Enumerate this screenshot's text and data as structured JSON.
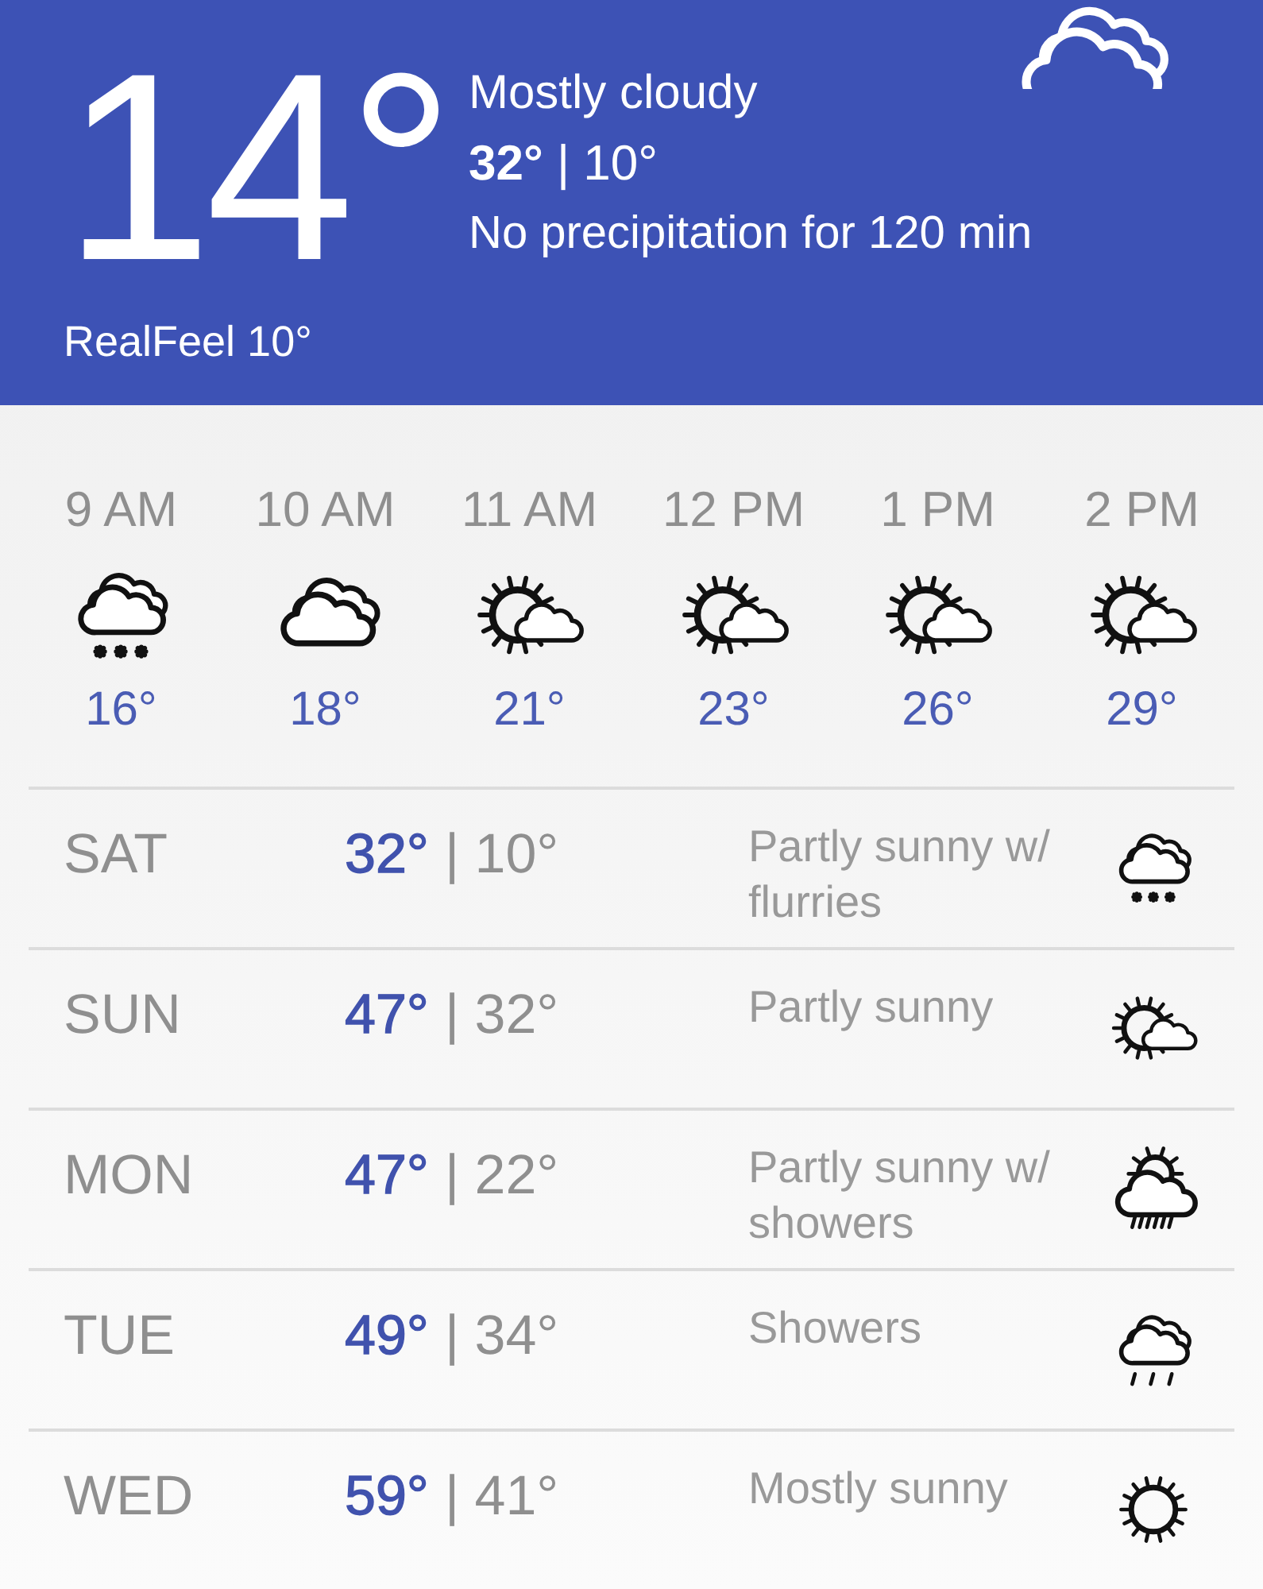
{
  "current": {
    "temperature": "14°",
    "condition": "Mostly cloudy",
    "high_low": "**32°** | 10°",
    "precipitation": "No precipitation for 120 min",
    "realfeel": "RealFeel 10°",
    "kind": "cloudy"
  },
  "hourly": [
    {
      "time": "9 AM",
      "kind": "snow",
      "temperature": "16°"
    },
    {
      "time": "10 AM",
      "kind": "cloudy",
      "temperature": "18°"
    },
    {
      "time": "11 AM",
      "kind": "partly-sunny",
      "temperature": "21°"
    },
    {
      "time": "12 PM",
      "kind": "partly-sunny",
      "temperature": "23°"
    },
    {
      "time": "1 PM",
      "kind": "partly-sunny",
      "temperature": "26°"
    },
    {
      "time": "2 PM",
      "kind": "partly-sunny",
      "temperature": "29°"
    }
  ],
  "daily": [
    {
      "day": "SAT",
      "high": "32°",
      "low": "| 10°",
      "condition": "Partly sunny w/ flurries",
      "kind": "snow"
    },
    {
      "day": "SUN",
      "high": "47°",
      "low": "| 32°",
      "condition": "Partly sunny",
      "kind": "partly-sunny"
    },
    {
      "day": "MON",
      "high": "47°",
      "low": "| 22°",
      "condition": "Partly sunny w/ showers",
      "kind": "partly-sunny-rain"
    },
    {
      "day": "TUE",
      "high": "49°",
      "low": "| 34°",
      "condition": "Showers",
      "kind": "rain"
    },
    {
      "day": "WED",
      "high": "59°",
      "low": "| 41°",
      "condition": "Mostly sunny",
      "kind": "sunny"
    }
  ]
}
